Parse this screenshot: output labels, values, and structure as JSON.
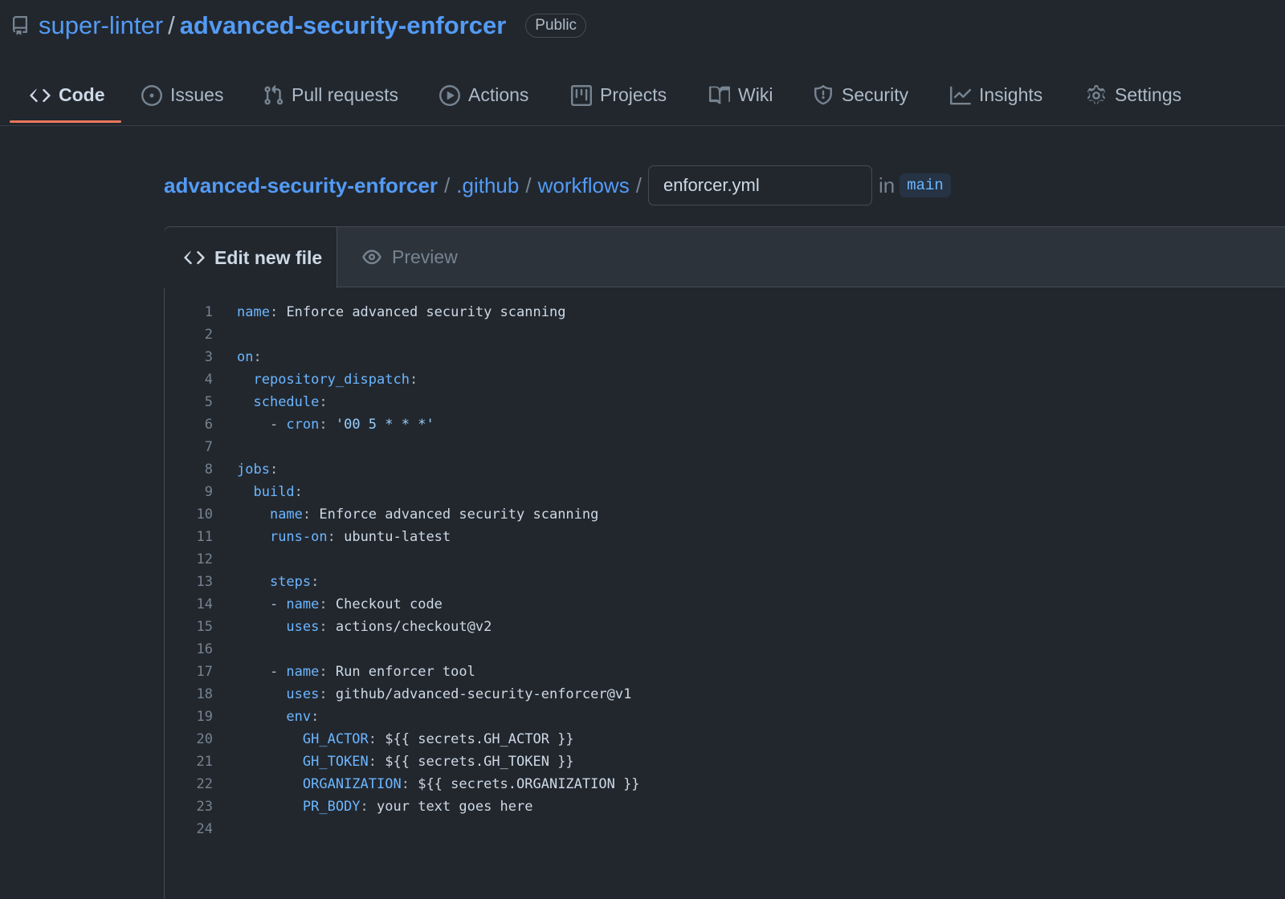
{
  "repo": {
    "owner": "super-linter",
    "separator": "/",
    "name": "advanced-security-enforcer",
    "visibility": "Public"
  },
  "nav": {
    "tabs": [
      {
        "label": "Code",
        "icon": "code-icon",
        "active": true
      },
      {
        "label": "Issues",
        "icon": "issue-icon"
      },
      {
        "label": "Pull requests",
        "icon": "pull-request-icon"
      },
      {
        "label": "Actions",
        "icon": "play-icon"
      },
      {
        "label": "Projects",
        "icon": "project-icon"
      },
      {
        "label": "Wiki",
        "icon": "book-icon"
      },
      {
        "label": "Security",
        "icon": "shield-icon"
      },
      {
        "label": "Insights",
        "icon": "graph-icon"
      },
      {
        "label": "Settings",
        "icon": "gear-icon"
      }
    ]
  },
  "breadcrumb": {
    "repo": "advanced-security-enforcer",
    "dir1": ".github",
    "dir2": "workflows",
    "sep": "/",
    "filename": "enforcer.yml",
    "in_label": "in",
    "branch": "main"
  },
  "editor": {
    "tab_edit": "Edit new file",
    "tab_preview": "Preview",
    "lines": [
      [
        {
          "t": "name",
          "c": "k"
        },
        {
          "t": ": ",
          "c": "p"
        },
        {
          "t": "Enforce advanced security scanning",
          "c": "v"
        }
      ],
      [],
      [
        {
          "t": "on",
          "c": "k"
        },
        {
          "t": ":",
          "c": "p"
        }
      ],
      [
        {
          "t": "  "
        },
        {
          "t": "repository_dispatch",
          "c": "k"
        },
        {
          "t": ":",
          "c": "p"
        }
      ],
      [
        {
          "t": "  "
        },
        {
          "t": "schedule",
          "c": "k"
        },
        {
          "t": ":",
          "c": "p"
        }
      ],
      [
        {
          "t": "    - ",
          "c": "p"
        },
        {
          "t": "cron",
          "c": "k"
        },
        {
          "t": ": ",
          "c": "p"
        },
        {
          "t": "'00 5 * * *'",
          "c": "s"
        }
      ],
      [],
      [
        {
          "t": "jobs",
          "c": "k"
        },
        {
          "t": ":",
          "c": "p"
        }
      ],
      [
        {
          "t": "  "
        },
        {
          "t": "build",
          "c": "k"
        },
        {
          "t": ":",
          "c": "p"
        }
      ],
      [
        {
          "t": "    "
        },
        {
          "t": "name",
          "c": "k"
        },
        {
          "t": ": ",
          "c": "p"
        },
        {
          "t": "Enforce advanced security scanning",
          "c": "v"
        }
      ],
      [
        {
          "t": "    "
        },
        {
          "t": "runs-on",
          "c": "k"
        },
        {
          "t": ": ",
          "c": "p"
        },
        {
          "t": "ubuntu-latest",
          "c": "v"
        }
      ],
      [],
      [
        {
          "t": "    "
        },
        {
          "t": "steps",
          "c": "k"
        },
        {
          "t": ":",
          "c": "p"
        }
      ],
      [
        {
          "t": "    - ",
          "c": "p"
        },
        {
          "t": "name",
          "c": "k"
        },
        {
          "t": ": ",
          "c": "p"
        },
        {
          "t": "Checkout code",
          "c": "v"
        }
      ],
      [
        {
          "t": "      "
        },
        {
          "t": "uses",
          "c": "k"
        },
        {
          "t": ": ",
          "c": "p"
        },
        {
          "t": "actions/checkout@v2",
          "c": "v"
        }
      ],
      [],
      [
        {
          "t": "    - ",
          "c": "p"
        },
        {
          "t": "name",
          "c": "k"
        },
        {
          "t": ": ",
          "c": "p"
        },
        {
          "t": "Run enforcer tool",
          "c": "v"
        }
      ],
      [
        {
          "t": "      "
        },
        {
          "t": "uses",
          "c": "k"
        },
        {
          "t": ": ",
          "c": "p"
        },
        {
          "t": "github/advanced-security-enforcer@v1",
          "c": "v"
        }
      ],
      [
        {
          "t": "      "
        },
        {
          "t": "env",
          "c": "k"
        },
        {
          "t": ":",
          "c": "p"
        }
      ],
      [
        {
          "t": "        "
        },
        {
          "t": "GH_ACTOR",
          "c": "k"
        },
        {
          "t": ": ",
          "c": "p"
        },
        {
          "t": "${{ secrets.GH_ACTOR }}",
          "c": "v"
        }
      ],
      [
        {
          "t": "        "
        },
        {
          "t": "GH_TOKEN",
          "c": "k"
        },
        {
          "t": ": ",
          "c": "p"
        },
        {
          "t": "${{ secrets.GH_TOKEN }}",
          "c": "v"
        }
      ],
      [
        {
          "t": "        "
        },
        {
          "t": "ORGANIZATION",
          "c": "k"
        },
        {
          "t": ": ",
          "c": "p"
        },
        {
          "t": "${{ secrets.ORGANIZATION }}",
          "c": "v"
        }
      ],
      [
        {
          "t": "        "
        },
        {
          "t": "PR_BODY",
          "c": "k"
        },
        {
          "t": ": ",
          "c": "p"
        },
        {
          "t": "your text goes here",
          "c": "v"
        }
      ],
      []
    ]
  },
  "colors": {
    "background": "#22272e",
    "link": "#539bf5",
    "active_underline": "#ec775c",
    "yaml_key": "#6cb6ff"
  }
}
